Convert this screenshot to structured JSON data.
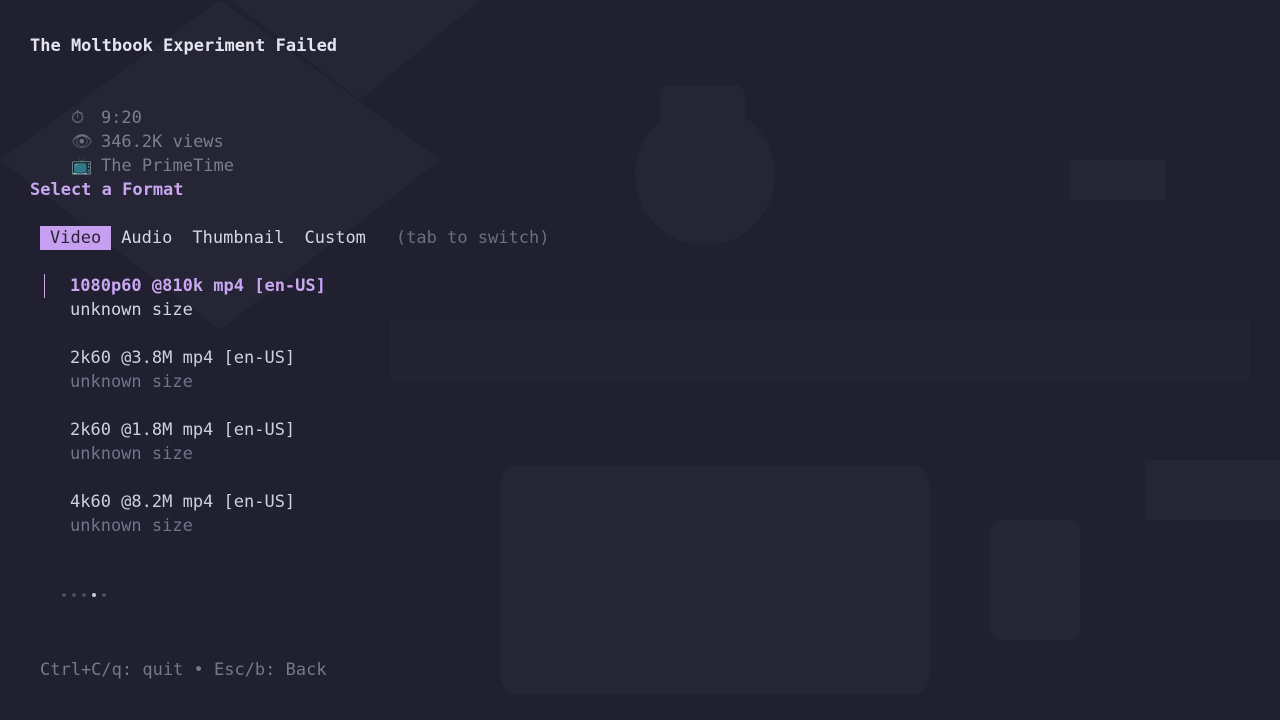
{
  "video": {
    "title": "The Moltbook Experiment Failed",
    "duration": "9:20",
    "views": "346.2K views",
    "channel": "The PrimeTime"
  },
  "icons": {
    "duration": "clock-icon",
    "views": "eye-icon",
    "channel": "tv-icon"
  },
  "heading": "Select a Format",
  "tabs": [
    {
      "label": "Video",
      "active": true
    },
    {
      "label": "Audio",
      "active": false
    },
    {
      "label": "Thumbnail",
      "active": false
    },
    {
      "label": "Custom",
      "active": false
    }
  ],
  "tab_hint": "(tab to switch)",
  "formats": [
    {
      "name": "1080p60 @810k mp4 [en-US]",
      "size": "unknown size",
      "selected": true
    },
    {
      "name": "2k60 @3.8M mp4 [en-US]",
      "size": "unknown size",
      "selected": false
    },
    {
      "name": "2k60 @1.8M mp4 [en-US]",
      "size": "unknown size",
      "selected": false
    },
    {
      "name": "4k60 @8.2M mp4 [en-US]",
      "size": "unknown size",
      "selected": false
    }
  ],
  "pagination": {
    "pages": 5,
    "current": 4
  },
  "footer": "Ctrl+C/q: quit • Esc/b: Back",
  "colors": {
    "accent": "#c79ff0",
    "background": "#202030"
  }
}
